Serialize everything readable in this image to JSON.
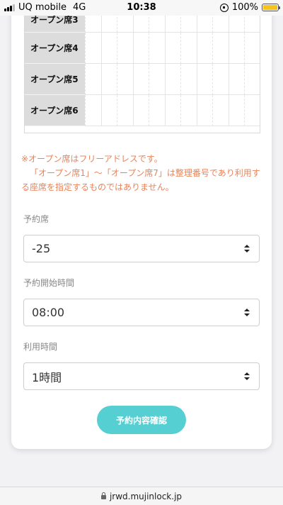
{
  "status_bar": {
    "carrier": "UQ mobile",
    "network": "4G",
    "time": "10:38",
    "battery": "100%"
  },
  "seat_table": {
    "rows": [
      "オープン席3",
      "オープン席4",
      "オープン席5",
      "オープン席6"
    ]
  },
  "notice": {
    "line1": "※オープン席はフリーアドレスです。",
    "line2": "「オープン席1」～「オープン席7」は整理番号であり利用する座席を指定するものではありません。"
  },
  "form": {
    "seat_label": "予約席",
    "seat_value": "-25",
    "start_label": "予約開始時間",
    "start_value": "08:00",
    "duration_label": "利用時間",
    "duration_value": "1時間",
    "confirm_label": "予約内容確認"
  },
  "browser": {
    "url": "jrwd.mujinlock.jp"
  },
  "colors": {
    "accent": "#55cfd1",
    "notice": "#e8845a",
    "battery": "#f6c31a"
  }
}
